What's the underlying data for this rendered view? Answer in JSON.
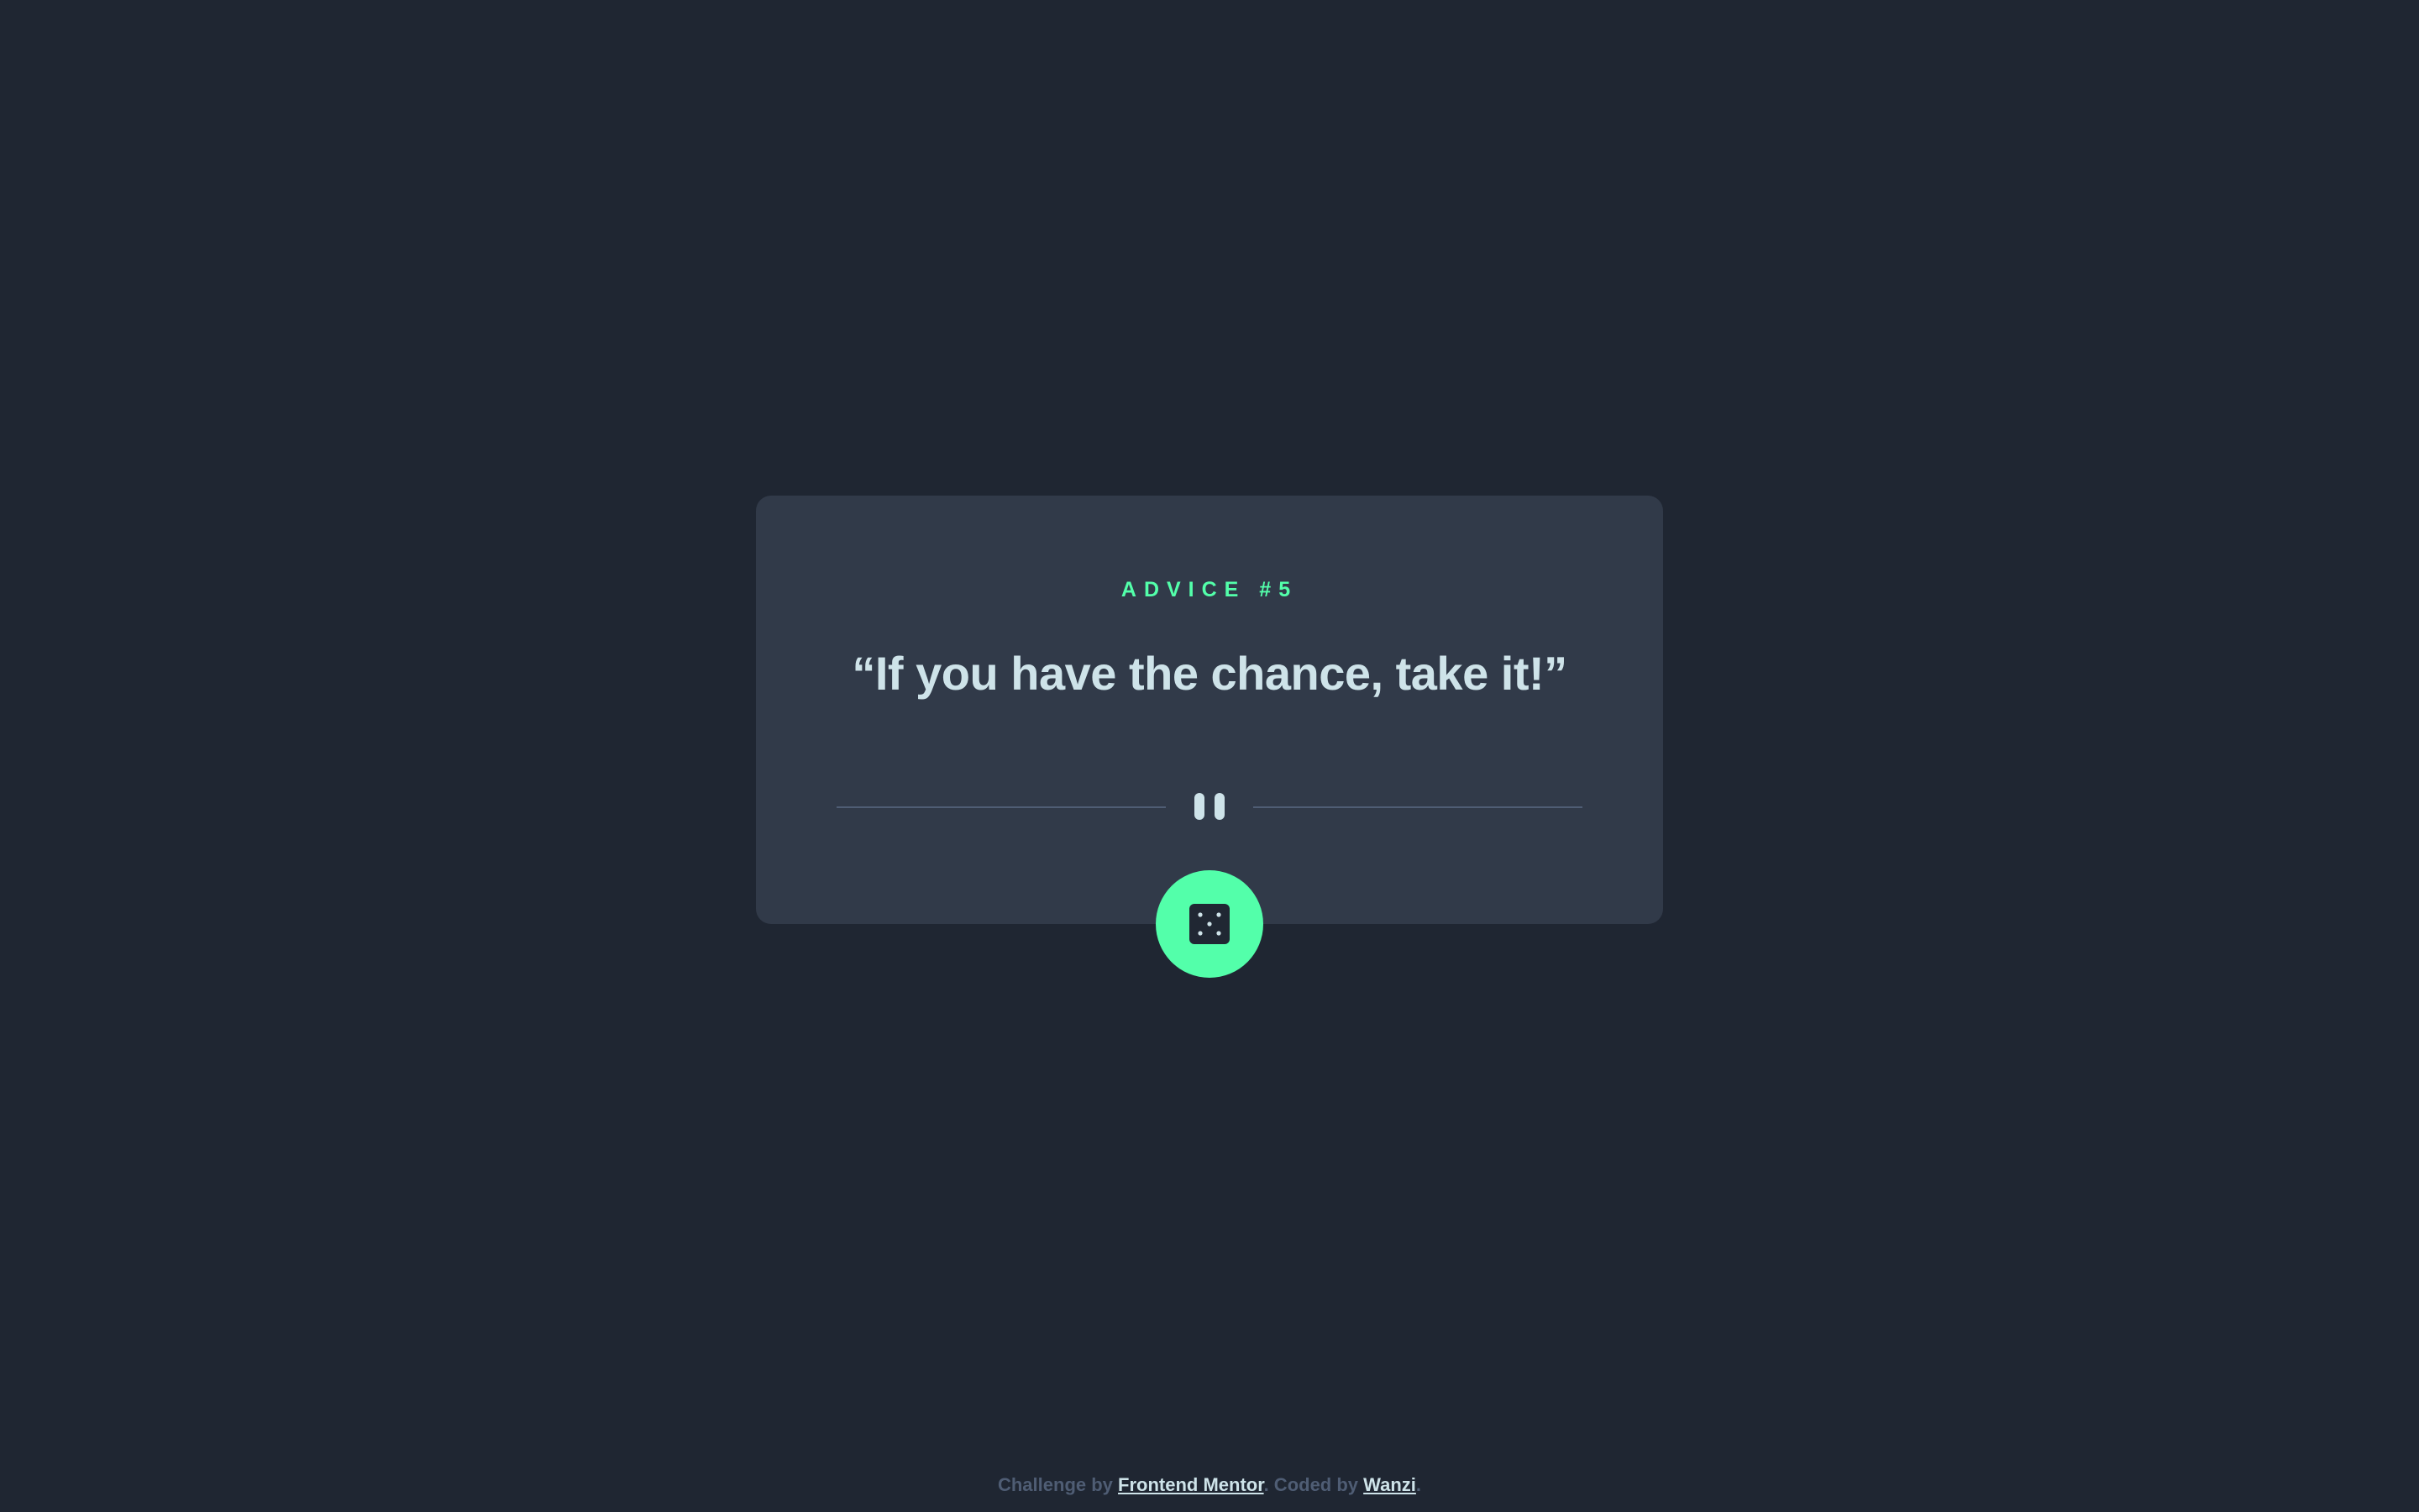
{
  "card": {
    "label_prefix": "ADVICE #",
    "advice_number": "5",
    "advice_text": "“If you have the chance, take it!”"
  },
  "icons": {
    "divider": "pause-icon",
    "button": "dice-icon"
  },
  "footer": {
    "challenge_prefix": "Challenge by ",
    "challenge_link": "Frontend Mentor",
    "separator": ". Coded by ",
    "author_link": "Wanzi",
    "suffix": "."
  },
  "colors": {
    "background": "#1f2632",
    "card": "#313a49",
    "accent": "#53ffaa",
    "text": "#cee3e9",
    "muted": "#4f5d74"
  }
}
